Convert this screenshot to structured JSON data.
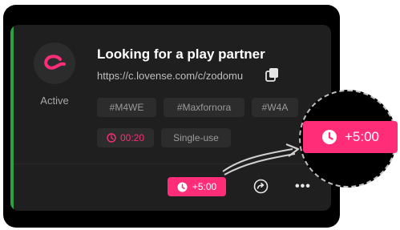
{
  "card": {
    "title": "Looking for a play partner",
    "url": "https://c.lovense.com/c/zodomu",
    "status": "Active",
    "tags": [
      "#M4WE",
      "#Maxfornora",
      "#W4A"
    ],
    "timer": "00:20",
    "usage": "Single-use",
    "extend_label": "+5:00"
  },
  "zoom": {
    "label": "+5:00"
  },
  "colors": {
    "accent": "#2ea043",
    "brand": "#ff2d78",
    "card_bg": "#1f1f1f",
    "tag_bg": "#2c2c2c"
  },
  "icons": [
    "lovense-logo-icon",
    "copy-icon",
    "clock-icon",
    "share-icon",
    "more-icon"
  ]
}
